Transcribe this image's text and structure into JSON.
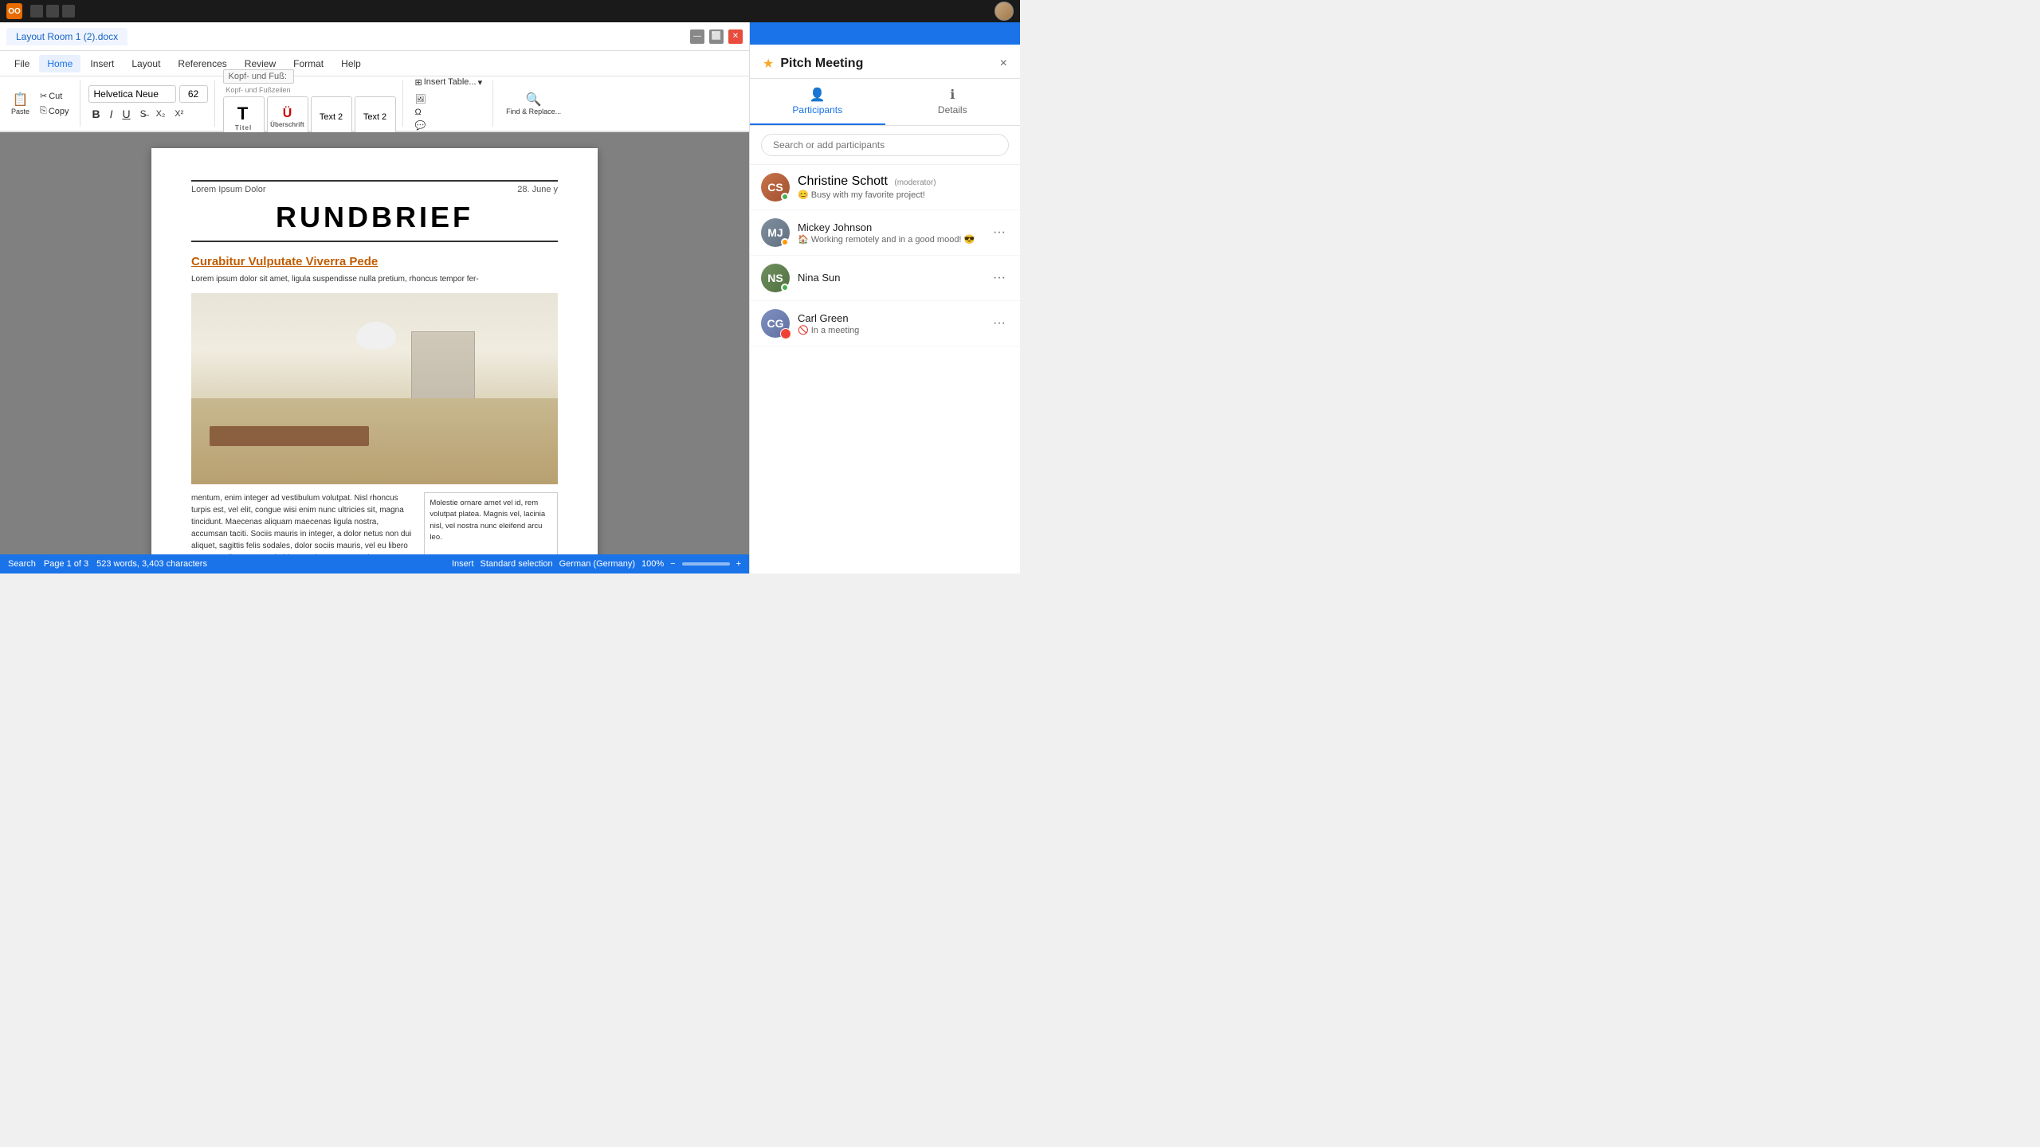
{
  "system_bar": {
    "logo": "OO",
    "title": "Layout Room 1 (2).docx"
  },
  "menu": {
    "items": [
      "File",
      "Home",
      "Insert",
      "Layout",
      "References",
      "Review",
      "Format",
      "Help"
    ],
    "active": "Home",
    "file_label": "File",
    "home_label": "Home",
    "insert_label": "Insert",
    "layout_label": "Layout",
    "references_label": "References",
    "review_label": "Review",
    "format_label": "Format",
    "help_label": "Help"
  },
  "ribbon": {
    "paste_label": "Paste",
    "cut_label": "Cut",
    "copy_label": "Copy",
    "font_name": "Helvetica Neue",
    "font_size": "62",
    "bold_label": "B",
    "italic_label": "I",
    "underline_label": "U",
    "style_tiles": [
      {
        "id": "titel",
        "display": "T",
        "label": "Titel"
      },
      {
        "id": "uberschrift",
        "display": "Ü",
        "label": "Überschrift"
      },
      {
        "id": "text2a",
        "display": "Text 2",
        "label": ""
      },
      {
        "id": "text2b",
        "display": "Text 2",
        "label": ""
      }
    ],
    "insert_table_label": "Insert Table...",
    "find_replace_label": "Find & Replace...",
    "kopf_fuss_label": "Kopf- und Fuß:",
    "kopf_fuss_sub": "Kopf- und Fußzeilen"
  },
  "document": {
    "header_left": "Lorem Ipsum Dolor",
    "header_right": "28. June y",
    "title": "RUNDBRIEF",
    "subtitle": "Curabitur Vulputate Viverra Pede",
    "intro_text": "Lorem ipsum dolor sit amet, ligula suspendisse nulla pretium, rhoncus tempor fer-",
    "body_text": "mentum, enim integer ad vestibulum volutpat. Nisl rhoncus turpis est, vel elit, congue wisi enim nunc ultricies sit, magna tincidunt. Maecenas aliquam maecenas ligula nostra, accumsan taciti. Sociis mauris in integer, a dolor netus non dui aliquet, sagittis felis sodales, dolor sociis mauris, vel eu libero cras. Faucibus at, Arcu habitasse elementum est, ipsum purus pede porttitor class, ut adipiscing, aliquet sed auctor, imperdiet arcu per diam dapibus libero duis. Enim eros in vel, volutpat nec pellentesque leo, temporibus scelerisque nec. Ac dolor ac adipiscing amet bibendum nullam, lacus molestie ut libero nec, diam et, pharetra soda-",
    "side_text": "Molestie ornare amet vel id, rem volutpat platea. Magnis vel, lacinia nisl, vel nostra nunc eleifend arcu leo."
  },
  "status_bar": {
    "page_info": "Page 1 of 3",
    "word_count": "523 words, 3,403 characters",
    "insert_label": "Insert",
    "selection_label": "Standard selection",
    "language": "German (Germany)",
    "zoom": "100%",
    "search_label": "Search"
  },
  "sidebar": {
    "title": "Pitch Meeting",
    "close_label": "×",
    "tabs": [
      {
        "id": "participants",
        "label": "Participants",
        "icon": "👤"
      },
      {
        "id": "details",
        "label": "Details",
        "icon": "ℹ"
      }
    ],
    "active_tab": "participants",
    "search_placeholder": "Search or add participants",
    "participants": [
      {
        "id": "christine",
        "name": "Christine Schott",
        "role": "(moderator)",
        "status": "😊 Busy with my favorite project!",
        "avatar_label": "CS",
        "online_status": "online"
      },
      {
        "id": "mickey",
        "name": "Mickey Johnson",
        "role": "",
        "status": "🏠 Working remotely and in a good mood! 😎",
        "avatar_label": "MJ",
        "online_status": "away"
      },
      {
        "id": "nina",
        "name": "Nina Sun",
        "role": "",
        "status": "",
        "avatar_label": "NS",
        "online_status": "online"
      },
      {
        "id": "carl",
        "name": "Carl Green",
        "role": "",
        "status": "🚫 In a meeting",
        "avatar_label": "CG",
        "online_status": "busy"
      }
    ]
  }
}
